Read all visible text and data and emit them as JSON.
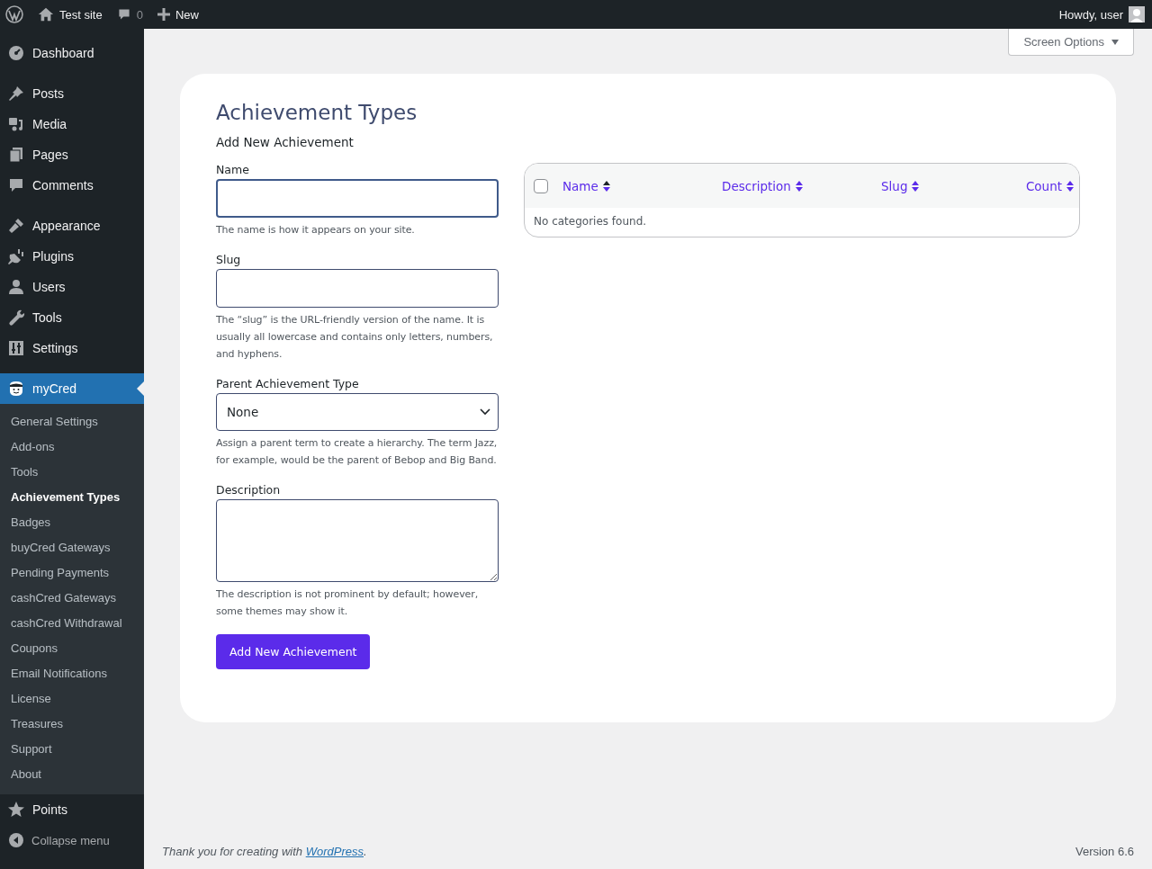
{
  "admin_bar": {
    "site_name": "Test site",
    "comments_count": "0",
    "new_label": "New",
    "greeting": "Howdy, user"
  },
  "sidebar": {
    "items": [
      {
        "label": "Dashboard",
        "selected": false,
        "group_start": false
      },
      {
        "label": "Posts",
        "selected": false,
        "group_start": true
      },
      {
        "label": "Media",
        "selected": false,
        "group_start": false
      },
      {
        "label": "Pages",
        "selected": false,
        "group_start": false
      },
      {
        "label": "Comments",
        "selected": false,
        "group_start": false
      },
      {
        "label": "Appearance",
        "selected": false,
        "group_start": true
      },
      {
        "label": "Plugins",
        "selected": false,
        "group_start": false
      },
      {
        "label": "Users",
        "selected": false,
        "group_start": false
      },
      {
        "label": "Tools",
        "selected": false,
        "group_start": false
      },
      {
        "label": "Settings",
        "selected": false,
        "group_start": false
      },
      {
        "label": "myCred",
        "selected": true,
        "group_start": true
      }
    ],
    "submenu": [
      {
        "label": "General Settings",
        "selected": false
      },
      {
        "label": "Add-ons",
        "selected": false
      },
      {
        "label": "Tools",
        "selected": false
      },
      {
        "label": "Achievement Types",
        "selected": true
      },
      {
        "label": "Badges",
        "selected": false
      },
      {
        "label": "buyCred Gateways",
        "selected": false
      },
      {
        "label": "Pending Payments",
        "selected": false
      },
      {
        "label": "cashCred Gateways",
        "selected": false
      },
      {
        "label": "cashCred Withdrawal",
        "selected": false
      },
      {
        "label": "Coupons",
        "selected": false
      },
      {
        "label": "Email Notifications",
        "selected": false
      },
      {
        "label": "License",
        "selected": false
      },
      {
        "label": "Treasures",
        "selected": false
      },
      {
        "label": "Support",
        "selected": false
      },
      {
        "label": "About",
        "selected": false
      }
    ],
    "after_items": [
      {
        "label": "Points",
        "selected": false
      }
    ],
    "collapse_label": "Collapse menu"
  },
  "screen_options": "Screen Options",
  "page": {
    "title": "Achievement Types",
    "form_title": "Add New Achievement",
    "fields": [
      {
        "kind": "input",
        "label": "Name",
        "focused": true,
        "help": "The name is how it appears on your site."
      },
      {
        "kind": "input",
        "label": "Slug",
        "focused": false,
        "help": "The “slug” is the URL-friendly version of the name. It is usually all lowercase and contains only letters, numbers, and hyphens."
      },
      {
        "kind": "select",
        "label": "Parent Achievement Type",
        "value": "None",
        "focused": false,
        "help": "Assign a parent term to create a hierarchy. The term Jazz, for example, would be the parent of Bebop and Big Band."
      },
      {
        "kind": "textarea",
        "label": "Description",
        "focused": false,
        "help": "The description is not prominent by default; however, some themes may show it."
      }
    ],
    "submit": "Add New Achievement"
  },
  "table": {
    "select_all_checked": false,
    "columns": [
      {
        "label": "Name",
        "sorted": true
      },
      {
        "label": "Description",
        "sorted": false
      },
      {
        "label": "Slug",
        "sorted": false
      },
      {
        "label": "Count",
        "sorted": false
      }
    ],
    "empty_message": "No categories found."
  },
  "footer": {
    "thanks_before": "Thank you for creating with ",
    "link": "WordPress",
    "thanks_after": ".",
    "version": "Version 6.6"
  }
}
